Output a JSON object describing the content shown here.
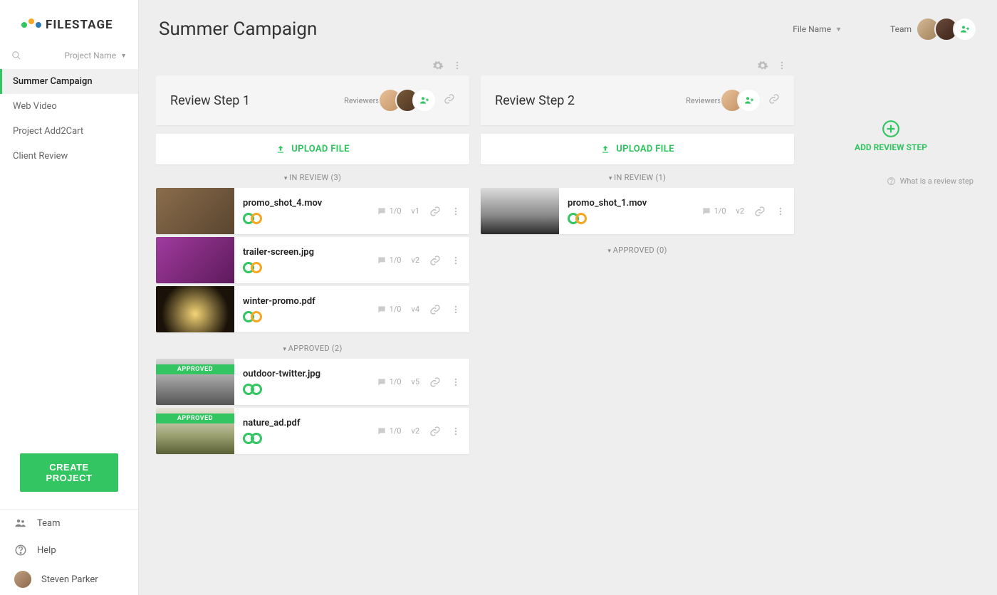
{
  "brand": {
    "name": "FILESTAGE"
  },
  "sidebar": {
    "project_sort_label": "Project Name",
    "projects": [
      {
        "name": "Summer Campaign",
        "active": true
      },
      {
        "name": "Web Video",
        "active": false
      },
      {
        "name": "Project Add2Cart",
        "active": false
      },
      {
        "name": "Client Review",
        "active": false
      }
    ],
    "create_project_label": "CREATE PROJECT",
    "footer": {
      "team_label": "Team",
      "help_label": "Help",
      "user_name": "Steven Parker"
    }
  },
  "header": {
    "title": "Summer Campaign",
    "file_sort_label": "File Name",
    "team_label": "Team"
  },
  "steps": [
    {
      "title": "Review Step 1",
      "reviewers_label": "Reviewers",
      "reviewer_count": 2,
      "upload_label": "UPLOAD FILE",
      "groups": [
        {
          "label": "IN REVIEW (3)",
          "files": [
            {
              "name": "promo_shot_4.mov",
              "comments": "1/0",
              "version": "v1",
              "status": "review",
              "thumb": "logs"
            },
            {
              "name": "trailer-screen.jpg",
              "comments": "1/0",
              "version": "v2",
              "status": "review",
              "thumb": "flowers"
            },
            {
              "name": "winter-promo.pdf",
              "comments": "1/0",
              "version": "v4",
              "status": "review",
              "thumb": "lights"
            }
          ]
        },
        {
          "label": "APPROVED (2)",
          "files": [
            {
              "name": "outdoor-twitter.jpg",
              "comments": "1/0",
              "version": "v5",
              "status": "approved",
              "thumb": "bw1"
            },
            {
              "name": "nature_ad.pdf",
              "comments": "1/0",
              "version": "v2",
              "status": "approved",
              "thumb": "grass"
            }
          ]
        }
      ]
    },
    {
      "title": "Review Step 2",
      "reviewers_label": "Reviewers",
      "reviewer_count": 1,
      "upload_label": "UPLOAD FILE",
      "groups": [
        {
          "label": "IN REVIEW (1)",
          "files": [
            {
              "name": "promo_shot_1.mov",
              "comments": "1/0",
              "version": "v2",
              "status": "review",
              "thumb": "mountain"
            }
          ]
        },
        {
          "label": "APPROVED (0)",
          "files": []
        }
      ]
    }
  ],
  "add_step": {
    "label": "ADD REVIEW STEP",
    "help_text": "What is a review step"
  }
}
